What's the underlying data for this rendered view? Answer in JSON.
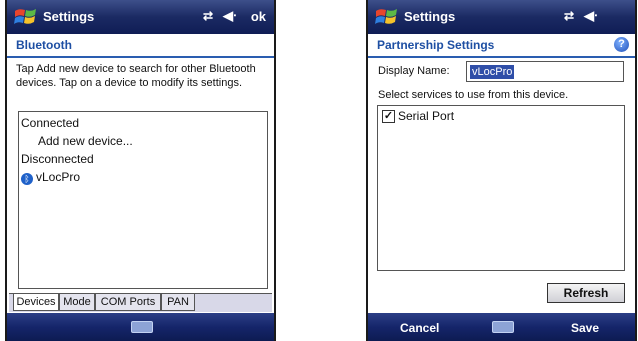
{
  "left_screen": {
    "title": "Settings",
    "status_ok": "ok",
    "header": "Bluetooth",
    "description": "Tap Add new device to search for other Bluetooth devices. Tap on a device to modify its settings.",
    "list": {
      "connected_label": "Connected",
      "add_device_label": "Add new device...",
      "disconnected_label": "Disconnected",
      "device_name": "vLocPro"
    },
    "tabs": [
      "Devices",
      "Mode",
      "COM Ports",
      "PAN"
    ]
  },
  "right_screen": {
    "title": "Settings",
    "header": "Partnership Settings",
    "display_name_label": "Display Name:",
    "display_name_value": "vLocPro",
    "services_label": "Select services to use from this device.",
    "services": [
      {
        "label": "Serial Port",
        "checked": true
      }
    ],
    "refresh_label": "Refresh",
    "softkeys": {
      "left": "Cancel",
      "right": "Save"
    }
  },
  "colors": {
    "title_bar": "#1b2a63",
    "header_text": "#1e4fa3",
    "selection": "#2f4ea8"
  },
  "icons": {
    "windows_logo": "windows-flag-icon",
    "connectivity": "connectivity-icon",
    "volume": "speaker-icon",
    "bluetooth": "bluetooth-icon",
    "help": "help-icon",
    "keyboard": "keyboard-icon"
  }
}
